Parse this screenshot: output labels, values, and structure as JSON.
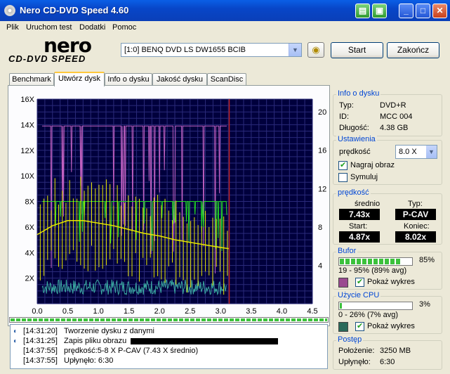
{
  "window": {
    "title": "Nero CD-DVD Speed 4.60"
  },
  "menu": [
    "Plik",
    "Uruchom test",
    "Dodatki",
    "Pomoc"
  ],
  "logo": {
    "brand": "nero",
    "product": "CD-DVD SPEED"
  },
  "toolbar": {
    "drive": "[1:0]   BENQ DVD LS DW1655 BCIB",
    "start": "Start",
    "stop": "Zakończ"
  },
  "tabs": [
    "Benchmark",
    "Utwórz dysk",
    "Info o dysku",
    "Jakość dysku",
    "ScanDisc"
  ],
  "active_tab": 1,
  "chart_data": {
    "type": "line",
    "x_ticks": [
      "0.0",
      "0.5",
      "1.0",
      "1.5",
      "2.0",
      "2.5",
      "3.0",
      "3.5",
      "4.0",
      "4.5"
    ],
    "y_left_ticks": [
      "2X",
      "4X",
      "6X",
      "8X",
      "10X",
      "12X",
      "14X",
      "16X"
    ],
    "y_right_ticks": [
      "4",
      "8",
      "12",
      "16",
      "20"
    ],
    "xlim": [
      0,
      4.5
    ],
    "ylim_left": [
      0,
      16
    ],
    "ylim_right": [
      0,
      21.33
    ],
    "end_marker_x": 3.14,
    "series": [
      {
        "color": "#e8e800",
        "kind": "write speed",
        "x": [
          0,
          0.25,
          0.5,
          0.75,
          1.0,
          1.25,
          1.5,
          1.75,
          2.0,
          2.25,
          2.5,
          2.75,
          3.0,
          3.14
        ],
        "y": [
          5.4,
          6.1,
          6.5,
          6.5,
          6.3,
          6.1,
          5.8,
          5.5,
          5.3,
          5.0,
          4.8,
          4.6,
          4.4,
          4.3
        ]
      },
      {
        "color": "#22dd22",
        "kind": "buffer",
        "x": [
          0.08,
          3.1
        ],
        "y": [
          8.0,
          8.0
        ]
      },
      {
        "color": "#c060c0",
        "kind": "cpu",
        "x": [
          0.08,
          3.1
        ],
        "y": [
          13.9,
          13.9
        ]
      },
      {
        "color": "#3aa8a0",
        "kind": "noise",
        "x": [
          0.08,
          3.1
        ],
        "y": [
          1.3,
          1.3
        ]
      }
    ]
  },
  "log": [
    {
      "time": "[14:31:20]",
      "text": "Tworzenie dysku z danymi",
      "icon": true
    },
    {
      "time": "[14:31:25]",
      "text": "Zapis pliku obrazu",
      "icon": true
    },
    {
      "time": "[14:37:55]",
      "text": "prędkość:5-8 X P-CAV (7.43 X średnio)",
      "icon": false
    },
    {
      "time": "[14:37:55]",
      "text": "Upłynęło:  6:30",
      "icon": false
    }
  ],
  "disc_info": {
    "title": "Info o dysku",
    "type_label": "Typ:",
    "type": "DVD+R",
    "id_label": "ID:",
    "id": "MCC 004",
    "length_label": "Długość:",
    "length": "4.38 GB"
  },
  "settings": {
    "title": "Ustawienia",
    "speed_label": "prędkość",
    "speed": "8.0 X",
    "write_label": "Nagraj obraz",
    "write_checked": true,
    "simulate_label": "Symuluj",
    "simulate_checked": false
  },
  "speed_box": {
    "title": "prędkość",
    "avg_label": "średnio",
    "avg": "7.43x",
    "type_label": "Typ:",
    "type": "P-CAV",
    "start_label": "Start:",
    "start": "4.87x",
    "end_label": "Koniec:",
    "end": "8.02x"
  },
  "buffer": {
    "title": "Bufor",
    "percent": "85%",
    "level": 0.85,
    "range": "19 - 95% (89% avg)",
    "show_label": "Pokaż wykres",
    "color": "#9a4a90"
  },
  "cpu": {
    "title": "Użycie CPU",
    "percent": "3%",
    "level": 0.03,
    "range": "0 - 26% (7% avg)",
    "show_label": "Pokaż wykres",
    "color": "#2a6a5a"
  },
  "progress": {
    "title": "Postęp",
    "position_label": "Położenie:",
    "position": "3250 MB",
    "elapsed_label": "Upłynęło:",
    "elapsed": "6:30"
  },
  "status_progress": 1.0
}
